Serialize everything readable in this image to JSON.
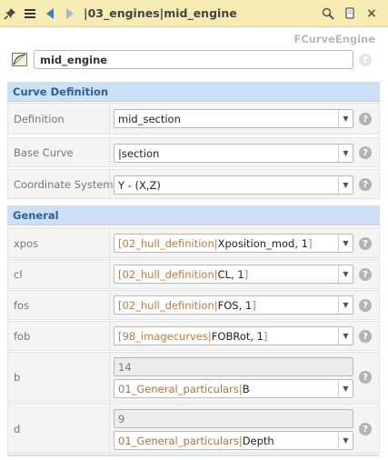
{
  "window": {
    "title": "|03_engines|mid_engine",
    "subtitle": "FCurveEngine"
  },
  "toolbar": {
    "icons": [
      "pin-icon",
      "list-icon",
      "back-arrow-icon",
      "forward-arrow-icon"
    ],
    "right_icons": [
      "magnify-icon",
      "copy-icon",
      "close-icon"
    ],
    "close_label": "×"
  },
  "object": {
    "name": "mid_engine",
    "icon": "curve-engine-icon"
  },
  "sections": {
    "curve_definition": "Curve Definition",
    "general": "General"
  },
  "fields": {
    "definition": {
      "label": "Definition",
      "value": "mid_section"
    },
    "base_curve": {
      "label": "Base Curve",
      "value": "|section"
    },
    "coordinate_system": {
      "label": "Coordinate System",
      "value": "Y - (X,Z)"
    },
    "xpos": {
      "label": "xpos",
      "ref": "02_hull_definition",
      "value": "Xposition_mod, 1"
    },
    "cl": {
      "label": "cl",
      "ref": "02_hull_definition",
      "value": "CL, 1"
    },
    "fos": {
      "label": "fos",
      "ref": "02_hull_definition",
      "value": "FOS, 1"
    },
    "fob": {
      "label": "fob",
      "ref": "98_imagecurves",
      "value": "FOBRot, 1"
    },
    "b": {
      "label": "b",
      "computed": "14",
      "ref": "01_General_particulars",
      "value": "B"
    },
    "d": {
      "label": "d",
      "computed": "9",
      "ref": "01_General_particulars",
      "value": "Depth"
    }
  },
  "help_label": "?",
  "colors": {
    "titlebar": "#f7edb4",
    "section_header": "#cde0f5",
    "section_text": "#2a5f9e",
    "reference": "#c8783a"
  }
}
